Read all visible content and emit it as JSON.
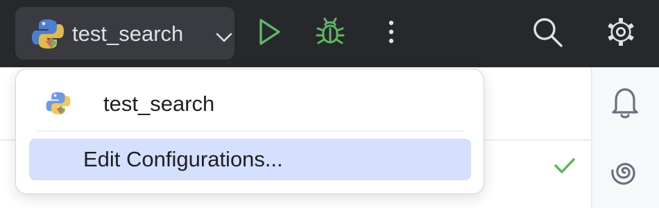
{
  "toolbar": {
    "run_config": {
      "label": "test_search",
      "icon": "python-icon"
    },
    "icons": [
      "chevron-down-icon",
      "run-icon",
      "debug-icon",
      "more-vertical-icon",
      "search-icon",
      "gear-icon"
    ],
    "colors": {
      "background": "#27282c",
      "widget": "#393b40",
      "run": "#5fb865",
      "icon": "#dfe1e5"
    }
  },
  "popup": {
    "items": [
      {
        "label": "test_search",
        "icon": "python-icon"
      },
      {
        "label": "Edit Configurations...",
        "selected": true
      }
    ],
    "colors": {
      "selected": "#d4e0fd"
    }
  },
  "editor": {
    "status_icon": "check-icon",
    "status_color": "#5fb865"
  },
  "right_strip": {
    "icons": [
      "bell-icon",
      "ai-assistant-icon"
    ]
  }
}
